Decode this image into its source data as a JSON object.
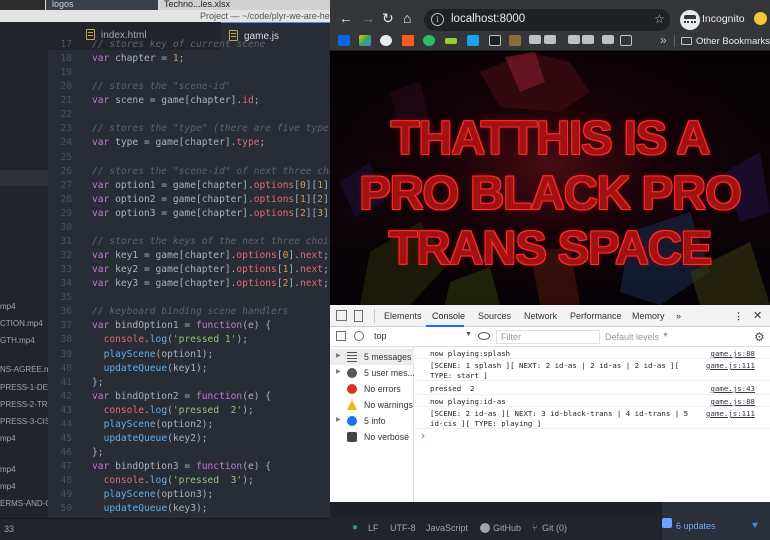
{
  "desktop": {
    "item1": "logos",
    "item2": "Techno...les.xlsx"
  },
  "atom": {
    "window_title": "Project — ~/code/plyr-we-are-he",
    "tree_items": [
      "mp4",
      "CTION.mp4",
      "GTH.mp4",
      "NS-AGREE.mp4",
      "PRESS-1-DEA",
      "PRESS-2-TR",
      "PRESS-3-CIS",
      "mp4",
      "mp4",
      "mp4",
      "ERMS-AND-C",
      "33"
    ],
    "tabs": [
      {
        "label": "index.html"
      },
      {
        "label": "game.js"
      }
    ],
    "status": {
      "line_ending": "LF",
      "encoding": "UTF-8",
      "grammar": "JavaScript",
      "github": "GitHub",
      "git": "Git (0)",
      "updates": "6 updates"
    }
  },
  "code_lines": [
    {
      "n": "17",
      "parts": [
        [
          "cm",
          "// stores key of current scene"
        ]
      ]
    },
    {
      "n": "18",
      "parts": [
        [
          "kw",
          "var"
        ],
        [
          "pl",
          " chapter = "
        ],
        [
          "nm",
          "1"
        ],
        [
          "pl",
          ";"
        ]
      ]
    },
    {
      "n": "19",
      "parts": []
    },
    {
      "n": "20",
      "parts": [
        [
          "cm",
          "// stores the \"scene-id\""
        ]
      ]
    },
    {
      "n": "21",
      "parts": [
        [
          "kw",
          "var"
        ],
        [
          "pl",
          " scene = game[chapter]."
        ],
        [
          "pr",
          "id"
        ],
        [
          "pl",
          ";"
        ]
      ]
    },
    {
      "n": "22",
      "parts": []
    },
    {
      "n": "23",
      "parts": [
        [
          "cm",
          "// stores the \"type\" (there are five types"
        ]
      ]
    },
    {
      "n": "24",
      "parts": [
        [
          "kw",
          "var"
        ],
        [
          "pl",
          " type = game[chapter]."
        ],
        [
          "pr",
          "type"
        ],
        [
          "pl",
          ";"
        ]
      ]
    },
    {
      "n": "25",
      "parts": []
    },
    {
      "n": "26",
      "parts": [
        [
          "cm",
          "// stores the \"scene-id\" of next three cho"
        ]
      ]
    },
    {
      "n": "27",
      "parts": [
        [
          "kw",
          "var"
        ],
        [
          "pl",
          " option1 = game[chapter]."
        ],
        [
          "pr",
          "options"
        ],
        [
          "pl",
          "["
        ],
        [
          "nm",
          "0"
        ],
        [
          "pl",
          "]["
        ],
        [
          "nm",
          "1"
        ],
        [
          "pl",
          "];"
        ]
      ]
    },
    {
      "n": "28",
      "parts": [
        [
          "kw",
          "var"
        ],
        [
          "pl",
          " option2 = game[chapter]."
        ],
        [
          "pr",
          "options"
        ],
        [
          "pl",
          "["
        ],
        [
          "nm",
          "1"
        ],
        [
          "pl",
          "]["
        ],
        [
          "nm",
          "2"
        ],
        [
          "pl",
          "];"
        ]
      ]
    },
    {
      "n": "29",
      "parts": [
        [
          "kw",
          "var"
        ],
        [
          "pl",
          " option3 = game[chapter]."
        ],
        [
          "pr",
          "options"
        ],
        [
          "pl",
          "["
        ],
        [
          "nm",
          "2"
        ],
        [
          "pl",
          "]["
        ],
        [
          "nm",
          "3"
        ],
        [
          "pl",
          "];"
        ]
      ]
    },
    {
      "n": "30",
      "parts": []
    },
    {
      "n": "31",
      "parts": [
        [
          "cm",
          "// stores the keys of the next three choic"
        ]
      ]
    },
    {
      "n": "32",
      "parts": [
        [
          "kw",
          "var"
        ],
        [
          "pl",
          " key1 = game[chapter]."
        ],
        [
          "pr",
          "options"
        ],
        [
          "pl",
          "["
        ],
        [
          "nm",
          "0"
        ],
        [
          "pl",
          "]."
        ],
        [
          "pr",
          "next"
        ],
        [
          "pl",
          ";"
        ]
      ]
    },
    {
      "n": "33",
      "parts": [
        [
          "kw",
          "var"
        ],
        [
          "pl",
          " key2 = game[chapter]."
        ],
        [
          "pr",
          "options"
        ],
        [
          "pl",
          "["
        ],
        [
          "nm",
          "1"
        ],
        [
          "pl",
          "]."
        ],
        [
          "pr",
          "next"
        ],
        [
          "pl",
          ";"
        ]
      ]
    },
    {
      "n": "34",
      "parts": [
        [
          "kw",
          "var"
        ],
        [
          "pl",
          " key3 = game[chapter]."
        ],
        [
          "pr",
          "options"
        ],
        [
          "pl",
          "["
        ],
        [
          "nm",
          "2"
        ],
        [
          "pl",
          "]."
        ],
        [
          "pr",
          "next"
        ],
        [
          "pl",
          ";"
        ]
      ]
    },
    {
      "n": "35",
      "parts": []
    },
    {
      "n": "36",
      "parts": [
        [
          "cm",
          "// keyboard binding scene handlers"
        ]
      ]
    },
    {
      "n": "37",
      "parts": [
        [
          "kw",
          "var"
        ],
        [
          "pl",
          " bindOption1 = "
        ],
        [
          "kw",
          "function"
        ],
        [
          "pl",
          "(e) {"
        ]
      ]
    },
    {
      "n": "38",
      "parts": [
        [
          "pl",
          "  "
        ],
        [
          "pr",
          "console"
        ],
        [
          "pl",
          "."
        ],
        [
          "fn",
          "log"
        ],
        [
          "pl",
          "("
        ],
        [
          "st",
          "'pressed 1'"
        ],
        [
          "pl",
          ");"
        ]
      ]
    },
    {
      "n": "39",
      "parts": [
        [
          "pl",
          "  "
        ],
        [
          "fn",
          "playScene"
        ],
        [
          "pl",
          "(option1);"
        ]
      ]
    },
    {
      "n": "40",
      "parts": [
        [
          "pl",
          "  "
        ],
        [
          "fn",
          "updateQueue"
        ],
        [
          "pl",
          "(key1);"
        ]
      ]
    },
    {
      "n": "41",
      "parts": [
        [
          "pl",
          "};"
        ]
      ]
    },
    {
      "n": "42",
      "parts": [
        [
          "kw",
          "var"
        ],
        [
          "pl",
          " bindOption2 = "
        ],
        [
          "kw",
          "function"
        ],
        [
          "pl",
          "(e) {"
        ]
      ]
    },
    {
      "n": "43",
      "parts": [
        [
          "pl",
          "  "
        ],
        [
          "pr",
          "console"
        ],
        [
          "pl",
          "."
        ],
        [
          "fn",
          "log"
        ],
        [
          "pl",
          "("
        ],
        [
          "st",
          "'pressed  2'"
        ],
        [
          "pl",
          ");"
        ]
      ]
    },
    {
      "n": "44",
      "parts": [
        [
          "pl",
          "  "
        ],
        [
          "fn",
          "playScene"
        ],
        [
          "pl",
          "(option2);"
        ]
      ]
    },
    {
      "n": "45",
      "parts": [
        [
          "pl",
          "  "
        ],
        [
          "fn",
          "updateQueue"
        ],
        [
          "pl",
          "(key2);"
        ]
      ]
    },
    {
      "n": "46",
      "parts": [
        [
          "pl",
          "};"
        ]
      ]
    },
    {
      "n": "47",
      "parts": [
        [
          "kw",
          "var"
        ],
        [
          "pl",
          " bindOption3 = "
        ],
        [
          "kw",
          "function"
        ],
        [
          "pl",
          "(e) {"
        ]
      ]
    },
    {
      "n": "48",
      "parts": [
        [
          "pl",
          "  "
        ],
        [
          "pr",
          "console"
        ],
        [
          "pl",
          "."
        ],
        [
          "fn",
          "log"
        ],
        [
          "pl",
          "("
        ],
        [
          "st",
          "'pressed  3'"
        ],
        [
          "pl",
          ");"
        ]
      ]
    },
    {
      "n": "49",
      "parts": [
        [
          "pl",
          "  "
        ],
        [
          "fn",
          "playScene"
        ],
        [
          "pl",
          "(option3);"
        ]
      ]
    },
    {
      "n": "50",
      "parts": [
        [
          "pl",
          "  "
        ],
        [
          "fn",
          "updateQueue"
        ],
        [
          "pl",
          "(key3);"
        ]
      ]
    }
  ],
  "browser": {
    "url": "localhost:8000",
    "profile_label": "Incognito",
    "other_bookmarks": "Other Bookmarks",
    "hero_lines": [
      "THATTHIS IS A",
      "PRO BLACK PRO",
      "TRANS SPACE"
    ]
  },
  "devtools": {
    "tabs": [
      "Elements",
      "Console",
      "Sources",
      "Network",
      "Performance",
      "Memory"
    ],
    "more_tabs": "»",
    "context": "top",
    "filter_placeholder": "Filter",
    "levels": "Default levels",
    "sidebar": [
      {
        "label": "5 messages",
        "icon": "list-icon"
      },
      {
        "label": "5 user mes...",
        "icon": "user-icon"
      },
      {
        "label": "No errors",
        "icon": "error-icon"
      },
      {
        "label": "No warnings",
        "icon": "warning-icon"
      },
      {
        "label": "5 info",
        "icon": "info-icon"
      },
      {
        "label": "No verbose",
        "icon": "verbose-icon"
      }
    ],
    "logs": [
      {
        "msg": "now playing:splash",
        "src": "game.js:88"
      },
      {
        "msg": "[SCENE: 1 splash ][ NEXT: 2 id-as | 2 id-as | 2 id-as ][\nTYPE: start ]",
        "src": "game.js:111"
      },
      {
        "msg": "pressed  2",
        "src": "game.js:43"
      },
      {
        "msg": "now playing:id-as",
        "src": "game.js:88"
      },
      {
        "msg": "[SCENE: 2 id-as ][ NEXT: 3 id-black-trans | 4 id-trans | 5\nid-cis ][ TYPE: playing ]",
        "src": "game.js:111"
      }
    ],
    "prompt": "›"
  },
  "colors": {
    "editor_bg": "#282c34",
    "hero_red": "#a31212",
    "accent_blue": "#1a73e8"
  }
}
